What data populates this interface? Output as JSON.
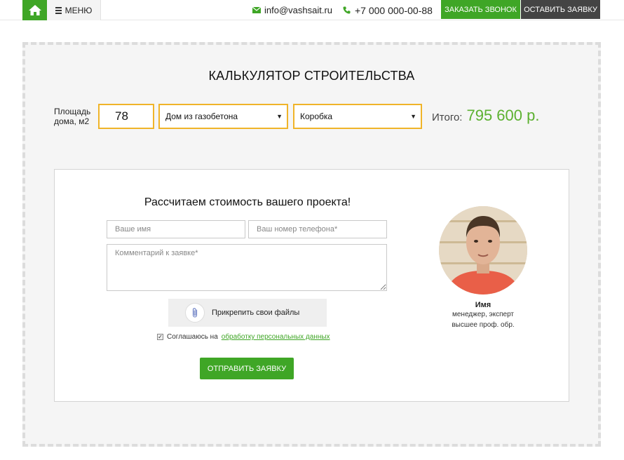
{
  "header": {
    "menu_label": "МЕНЮ",
    "email": "info@vashsait.ru",
    "phone": "+7 000 000-00-88",
    "call_button": "ЗАКАЗАТЬ ЗВОНОК",
    "request_button": "ОСТАВИТЬ ЗАЯВКУ",
    "icons": {
      "home": "home-icon",
      "menu": "hamburger-icon",
      "email": "envelope-icon",
      "phone": "phone-icon"
    }
  },
  "calculator": {
    "title": "КАЛЬКУЛЯТОР СТРОИТЕЛЬСТВА",
    "area_label": "Площадь дома, м2",
    "area_value": "78",
    "house_type": "Дом из газобетона",
    "build_stage": "Коробка",
    "total_label": "Итого:",
    "total_value": "795 600 р."
  },
  "form": {
    "title": "Рассчитаем стоимость вашего проекта!",
    "name_placeholder": "Ваше имя",
    "phone_placeholder": "Ваш номер телефона*",
    "comment_placeholder": "Комментарий к заявке*",
    "attach_label": "Прикрепить свои файлы",
    "consent_text": "Соглашаюсь на",
    "consent_link": "обработку персональных данных",
    "consent_checked": true,
    "submit_label": "ОТПРАВИТЬ ЗАЯВКУ"
  },
  "manager": {
    "name": "Имя",
    "role": "менеджер, эксперт",
    "education": "высшее проф. обр."
  },
  "colors": {
    "accent_green": "#3fa626",
    "dark_button": "#444444",
    "input_border": "#f0b429",
    "total_green": "#5cb130"
  }
}
